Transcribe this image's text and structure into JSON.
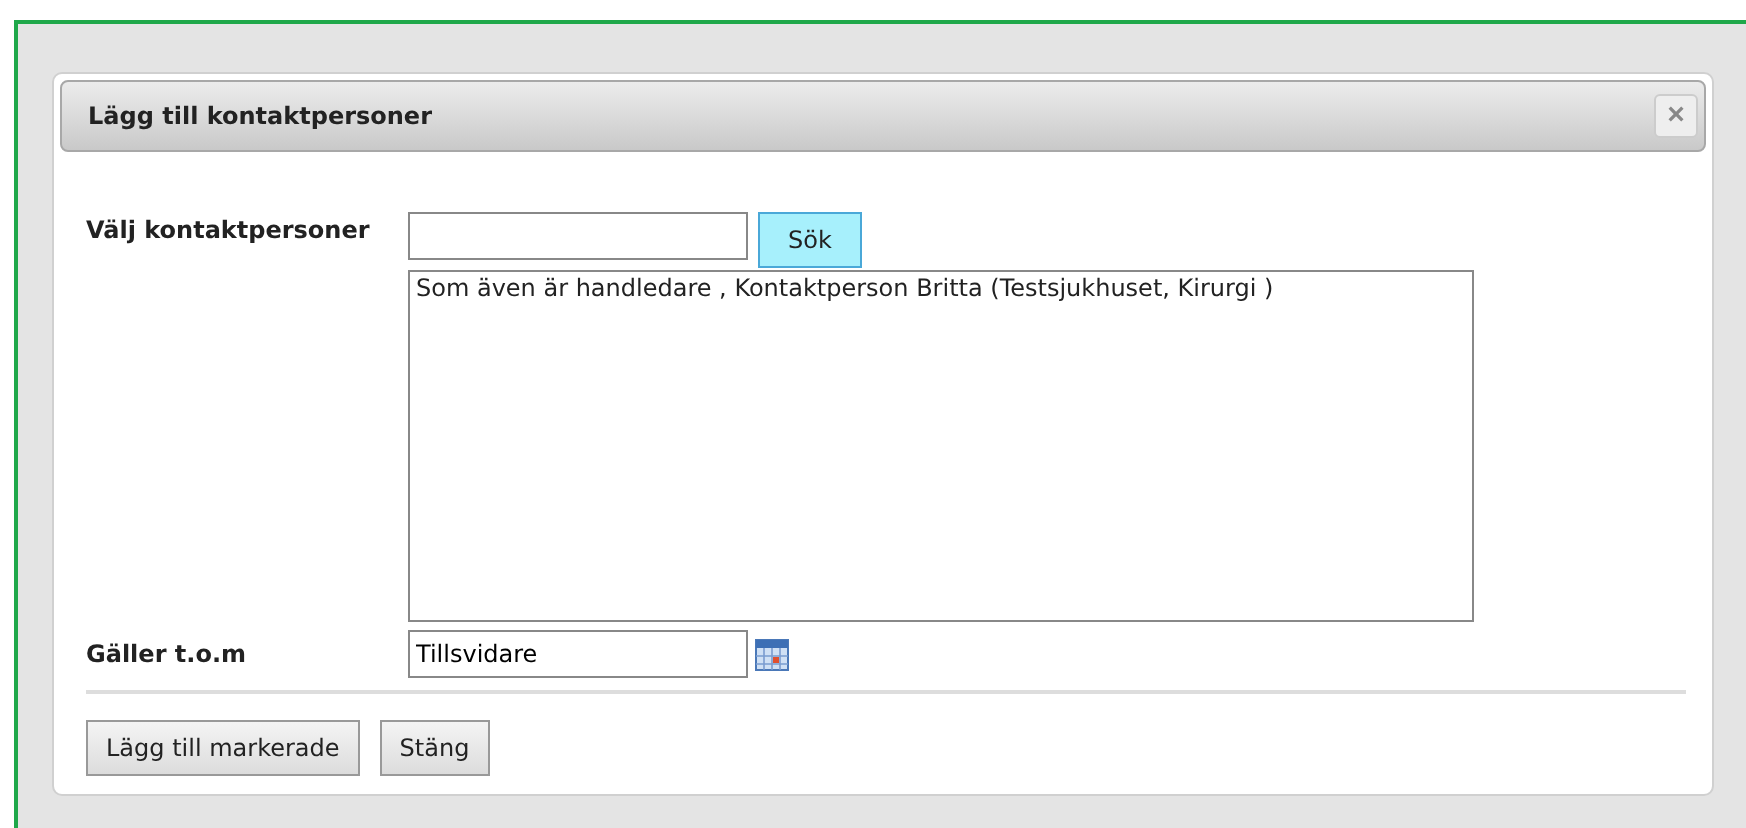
{
  "dialog": {
    "title": "Lägg till kontaktpersoner",
    "close": "×"
  },
  "search": {
    "label": "Välj kontaktpersoner",
    "button": "Sök"
  },
  "results": [
    {
      "text": "Som även är handledare , Kontaktperson Britta (Testsjukhuset, Kirurgi )",
      "selected": false
    }
  ],
  "valid_until": {
    "label": "Gäller t.o.m",
    "value": "Tillsvidare"
  },
  "buttons": [
    "Lägg till markerade",
    "Stäng"
  ]
}
